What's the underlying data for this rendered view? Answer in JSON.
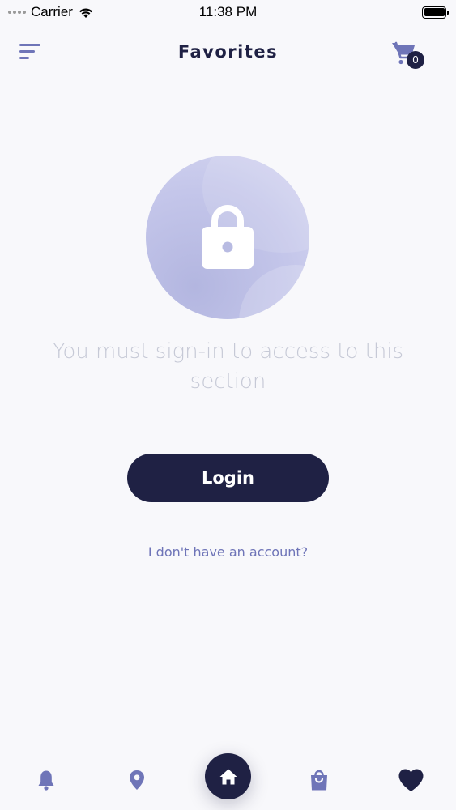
{
  "status_bar": {
    "carrier": "Carrier",
    "time": "11:38 PM"
  },
  "header": {
    "title": "Favorites",
    "cart_count": "0",
    "menu_icon": "menu-icon",
    "cart_icon": "cart-icon"
  },
  "main": {
    "illustration_icon": "lock-icon",
    "message": "You must sign-in to access to this section",
    "login_label": "Login",
    "no_account_label": "I don't have an account?"
  },
  "tab_bar": {
    "tabs": [
      {
        "icon": "bell-icon"
      },
      {
        "icon": "location-pin-icon"
      },
      {
        "icon": "home-icon"
      },
      {
        "icon": "shopping-bag-icon"
      },
      {
        "icon": "heart-icon"
      }
    ]
  },
  "colors": {
    "primary_dark": "#1f2144",
    "accent": "#6f75b8",
    "muted_text": "#c6c9d6",
    "background": "#f8f8fb"
  }
}
